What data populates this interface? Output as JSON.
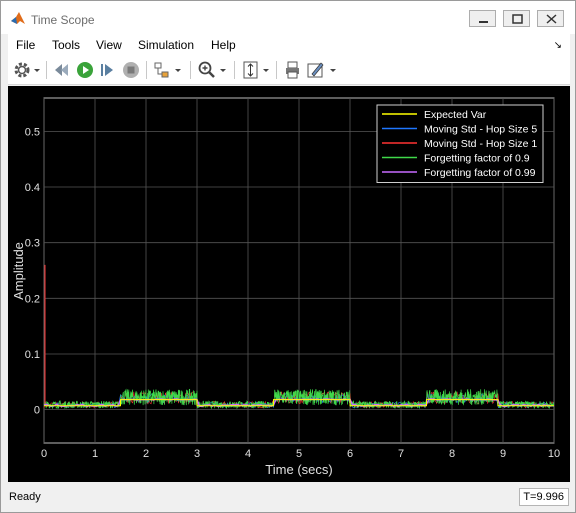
{
  "window": {
    "title": "Time Scope",
    "minimize_label": "",
    "maximize_label": "",
    "close_label": ""
  },
  "menu": {
    "items": [
      "File",
      "Tools",
      "View",
      "Simulation",
      "Help"
    ]
  },
  "toolbar": {
    "icons": [
      "gear-icon",
      "dropdown-arrow-icon",
      "step-back-icon",
      "run-icon",
      "step-forward-icon",
      "stop-icon",
      "highlight-blocks-icon",
      "dropdown-arrow-icon",
      "zoom-in-icon",
      "dropdown-arrow-icon",
      "scale-axes-icon",
      "dropdown-arrow-icon",
      "print-icon",
      "style-icon",
      "dropdown-arrow-icon"
    ]
  },
  "colors": {
    "axes_bg": "#000000",
    "grid": "#555555",
    "tick_text": "#e0e0e0",
    "expected_var": "#ffff00",
    "moving_std_5": "#1f77ff",
    "moving_std_1": "#ff3333",
    "forgetting_09": "#3fd84a",
    "forgetting_099": "#c86bff"
  },
  "chart_data": {
    "type": "line",
    "title": "",
    "xlabel": "Time (secs)",
    "ylabel": "Amplitude",
    "xlim": [
      0,
      10
    ],
    "ylim": [
      -0.06,
      0.56
    ],
    "grid": true,
    "legend_position": "top-right",
    "xticks": [
      "0",
      "1",
      "2",
      "3",
      "4",
      "5",
      "6",
      "7",
      "8",
      "9",
      "10"
    ],
    "yticks": [
      "0",
      "0.1",
      "0.2",
      "0.3",
      "0.4",
      "0.5"
    ],
    "segments": [
      {
        "start": 0,
        "end": 1.5,
        "expected": 0.007
      },
      {
        "start": 1.5,
        "end": 3.0,
        "expected": 0.018
      },
      {
        "start": 3.0,
        "end": 4.5,
        "expected": 0.007
      },
      {
        "start": 4.5,
        "end": 6.0,
        "expected": 0.018
      },
      {
        "start": 6.0,
        "end": 7.5,
        "expected": 0.007
      },
      {
        "start": 7.5,
        "end": 8.9,
        "expected": 0.018
      },
      {
        "start": 8.9,
        "end": 10.0,
        "expected": 0.007
      }
    ],
    "series": [
      {
        "name": "Expected Var",
        "color": "#ffff00"
      },
      {
        "name": "Moving Std - Hop Size 5",
        "color": "#1f77ff"
      },
      {
        "name": "Moving Std - Hop Size 1",
        "color": "#ff3333"
      },
      {
        "name": "Forgetting factor of 0.9",
        "color": "#3fd84a"
      },
      {
        "name": "Forgetting factor of 0.99",
        "color": "#c86bff"
      }
    ]
  },
  "status": {
    "text": "Ready",
    "time": "T=9.996"
  }
}
